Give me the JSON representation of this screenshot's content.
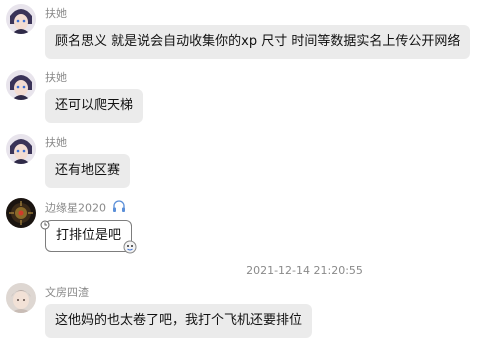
{
  "messages": [
    {
      "name": "扶她",
      "text": "顾名思义 就是说会自动收集你的xp 尺寸 时间等数据实名上传公开网络"
    },
    {
      "name": "扶她",
      "text": "还可以爬天梯"
    },
    {
      "name": "扶她",
      "text": "还有地区赛"
    },
    {
      "name": "边缘星2020",
      "text": "打排位是吧"
    },
    {
      "name": "文房四渣",
      "text": "这他妈的也太卷了吧，我打个飞机还要排位"
    }
  ],
  "timestamp": "2021-12-14 21:20:55",
  "colors": {
    "bubble": "#ebebeb",
    "meta_text": "#8a8a8a"
  }
}
